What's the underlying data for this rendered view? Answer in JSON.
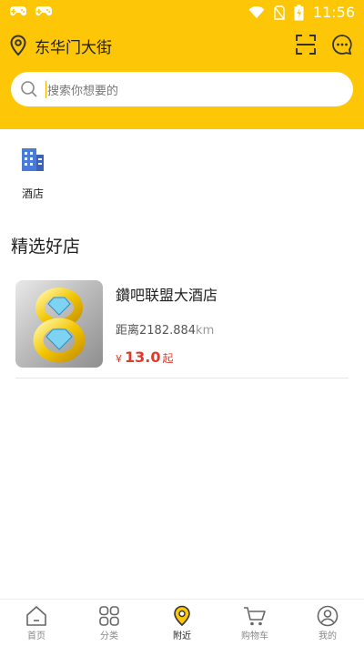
{
  "status_bar": {
    "time": "11:56"
  },
  "header": {
    "location": "东华门大街",
    "search_placeholder": "搜索你想要的"
  },
  "categories": [
    {
      "label": "酒店",
      "icon": "building-icon"
    }
  ],
  "section": {
    "title": "精选好店"
  },
  "hotels": [
    {
      "name": "鑽吧联盟大酒店",
      "distance_label": "距离",
      "distance_value": "2182.884",
      "distance_unit": "km",
      "currency": "¥",
      "price": "13.0",
      "price_suffix": "起"
    }
  ],
  "tabbar": {
    "items": [
      {
        "label": "首页",
        "icon": "home-icon"
      },
      {
        "label": "分类",
        "icon": "category-icon"
      },
      {
        "label": "附近",
        "icon": "nearby-location-icon"
      },
      {
        "label": "购物车",
        "icon": "cart-icon"
      },
      {
        "label": "我的",
        "icon": "profile-icon"
      }
    ],
    "active_index": 2
  },
  "colors": {
    "header_yellow": "#fdc707",
    "price_red": "#e03a2d",
    "category_blue": "#4a7bd8"
  }
}
